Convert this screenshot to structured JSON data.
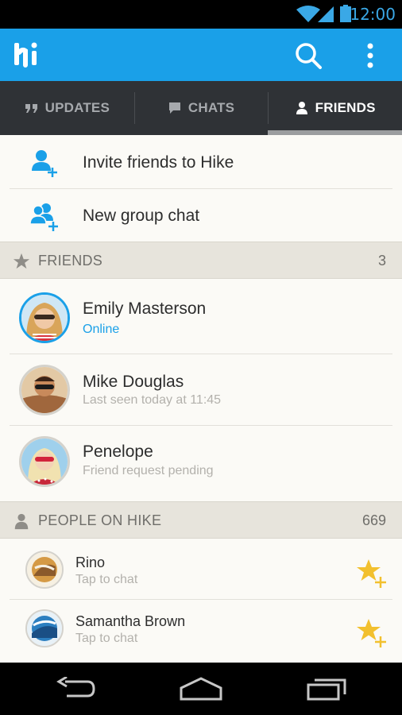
{
  "status_bar": {
    "time": "12:00"
  },
  "tabs": [
    {
      "label": "UPDATES",
      "icon": "quote-icon",
      "active": false
    },
    {
      "label": "CHATS",
      "icon": "chat-bubble-icon",
      "active": false
    },
    {
      "label": "FRIENDS",
      "icon": "person-icon",
      "active": true
    }
  ],
  "actions": {
    "invite": "Invite friends to Hike",
    "group_chat": "New group chat"
  },
  "friends_section": {
    "title": "FRIENDS",
    "count": "3"
  },
  "friends": [
    {
      "name": "Emily Masterson",
      "status": "Online"
    },
    {
      "name": "Mike Douglas",
      "status": "Last seen today at 11:45"
    },
    {
      "name": "Penelope",
      "status": "Friend request pending"
    }
  ],
  "people_section": {
    "title": "PEOPLE ON HIKE",
    "count": "669"
  },
  "people": [
    {
      "name": "Rino",
      "subtitle": "Tap to chat"
    },
    {
      "name": "Samantha Brown",
      "subtitle": "Tap to chat"
    }
  ],
  "colors": {
    "brand_blue": "#1aa0e8",
    "tab_bar": "#2f3236",
    "section_bg": "#e7e4dc",
    "favorite_yellow": "#f2c02e"
  }
}
